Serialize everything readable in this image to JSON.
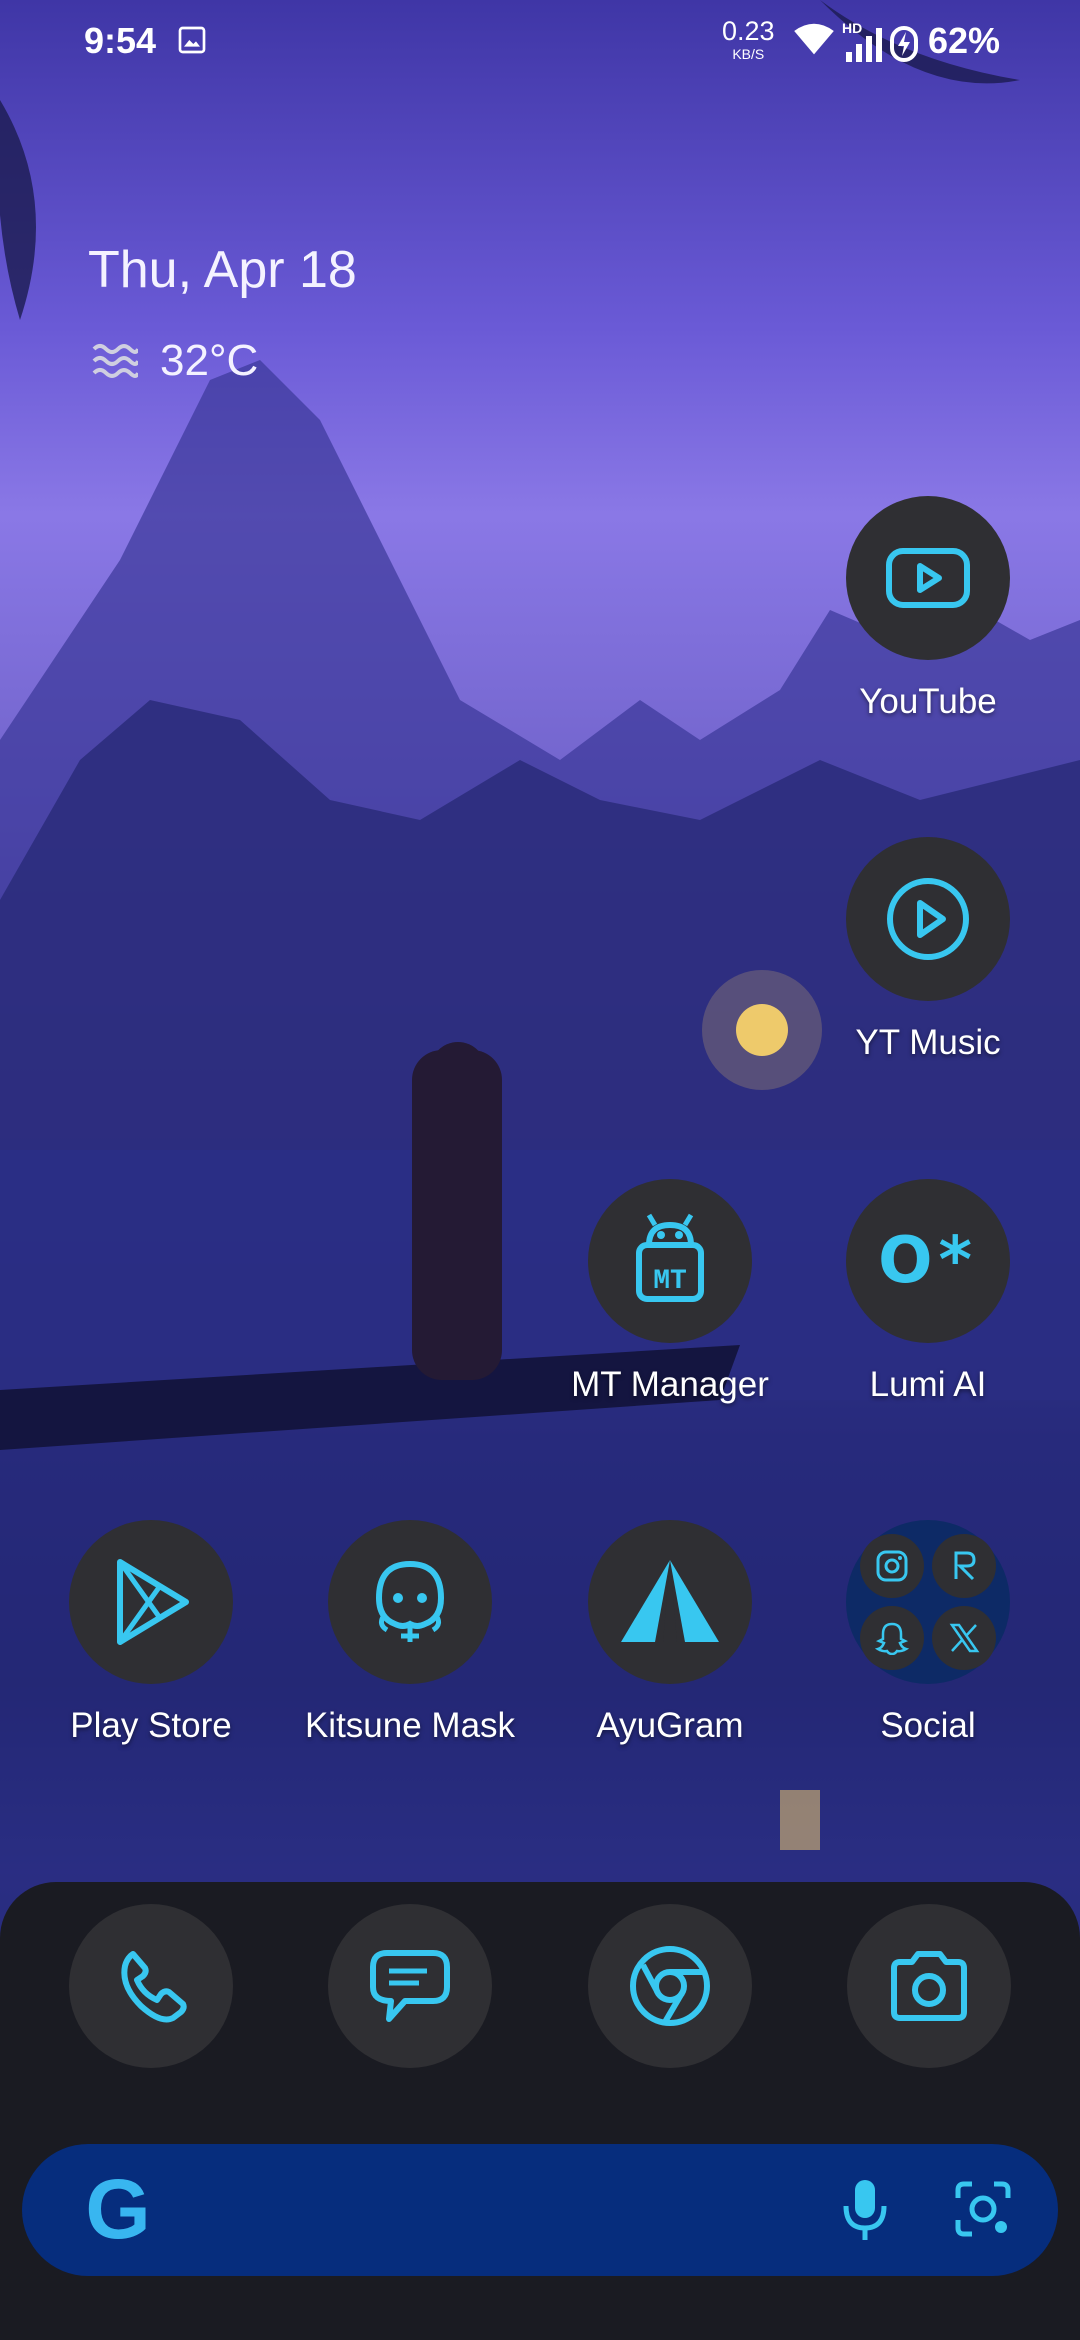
{
  "status_bar": {
    "time": "9:54",
    "net_speed_value": "0.23",
    "net_speed_unit": "KB/S",
    "signal_badge": "HD",
    "battery": "62%"
  },
  "widget": {
    "date": "Thu, Apr 18",
    "temperature": "32°C",
    "weather_icon": "haze-icon"
  },
  "apps": {
    "youtube": "YouTube",
    "yt_music": "YT Music",
    "mt_manager": "MT Manager",
    "lumi_ai": "Lumi AI",
    "mt_manager_glyph": "MT",
    "lumi_glyph": "O*",
    "play_store": "Play Store",
    "kitsune_mask": "Kitsune Mask",
    "ayugram": "AyuGram",
    "social_folder": "Social"
  },
  "dock": [
    "phone",
    "messages",
    "chrome",
    "camera"
  ],
  "search": {
    "logo": "G"
  },
  "colors": {
    "icon_accent": "#38c7f0",
    "icon_bg": "#2f2f33",
    "dock_bg": "#1a1b22",
    "search_bg": "#062d7d",
    "folder_bg": "#0d2a66"
  }
}
